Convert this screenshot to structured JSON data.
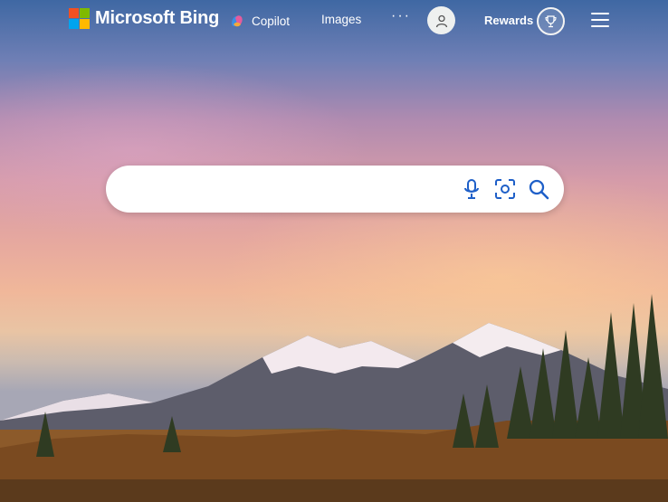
{
  "header": {
    "brand": "Microsoft Bing",
    "nav": [
      {
        "label": "Copilot",
        "icon": "copilot-icon"
      },
      {
        "label": "Images"
      }
    ],
    "more_label": "···",
    "avatar_icon": "user-icon",
    "rewards_label": "Rewards",
    "rewards_icon": "trophy-icon",
    "menu_icon": "hamburger-menu-icon"
  },
  "search": {
    "value": "",
    "placeholder": "",
    "icons": [
      "microphone-icon",
      "visual-search-icon",
      "search-icon"
    ],
    "accent": "#1e5fc8"
  },
  "colors": {
    "ms_red": "#f25022",
    "ms_green": "#7fba00",
    "ms_blue": "#00a4ef",
    "ms_yellow": "#ffb900"
  }
}
